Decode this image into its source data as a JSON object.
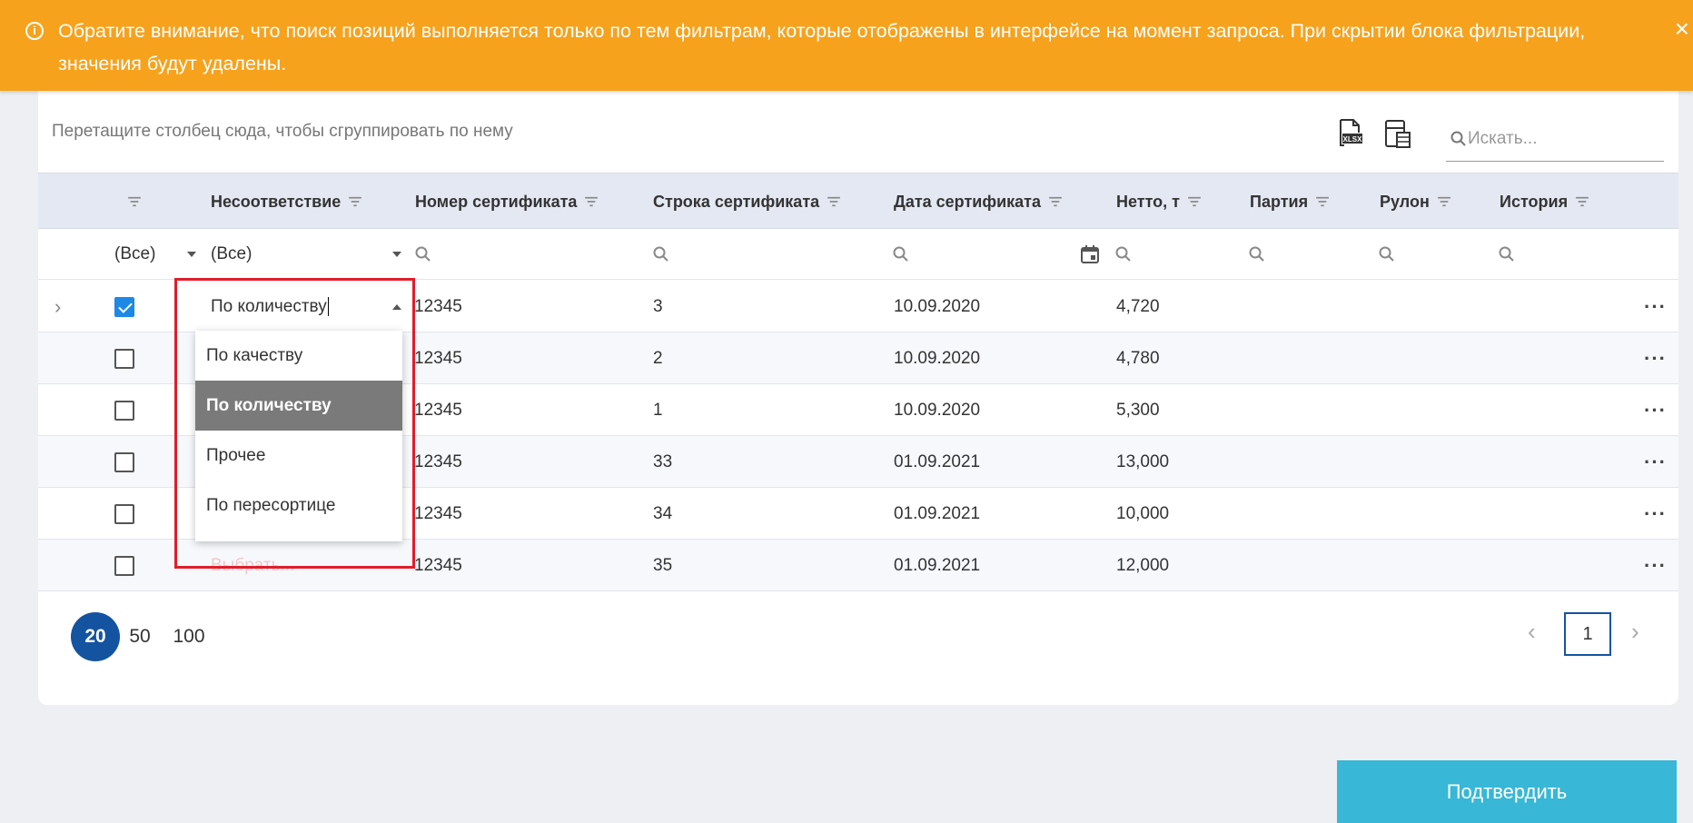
{
  "banner": {
    "text": "Обратите внимание, что поиск позиций выполняется только по тем фильтрам, которые отображены в интерфейсе на момент запроса. При скрытии блока фильтрации, значения будут удалены.",
    "icon": "info-icon",
    "close": "×"
  },
  "toolbar": {
    "group_hint": "Перетащите столбец сюда, чтобы сгруппировать по нему",
    "search_placeholder": "Искать..."
  },
  "columns": {
    "mismatch": "Несоответствие",
    "cert_number": "Номер сертификата",
    "cert_line": "Строка сертификата",
    "cert_date": "Дата сертификата",
    "net": "Нетто, т",
    "batch": "Партия",
    "roll": "Рулон",
    "history": "История"
  },
  "filters": {
    "select_all": "(Все)",
    "mismatch_all": "(Все)"
  },
  "rows": [
    {
      "checked": true,
      "mismatch": "По количеству",
      "cert_number": "12345",
      "cert_line": "3",
      "cert_date": "10.09.2020",
      "net": "4,720"
    },
    {
      "checked": false,
      "mismatch": "",
      "cert_number": "12345",
      "cert_line": "2",
      "cert_date": "10.09.2020",
      "net": "4,780"
    },
    {
      "checked": false,
      "mismatch": "",
      "cert_number": "12345",
      "cert_line": "1",
      "cert_date": "10.09.2020",
      "net": "5,300"
    },
    {
      "checked": false,
      "mismatch": "",
      "cert_number": "12345",
      "cert_line": "33",
      "cert_date": "01.09.2021",
      "net": "13,000"
    },
    {
      "checked": false,
      "mismatch": "",
      "cert_number": "12345",
      "cert_line": "34",
      "cert_date": "01.09.2021",
      "net": "10,000"
    },
    {
      "checked": false,
      "mismatch": "Выбрать...",
      "cert_number": "12345",
      "cert_line": "35",
      "cert_date": "01.09.2021",
      "net": "12,000"
    }
  ],
  "dropdown": {
    "options": [
      "По качеству",
      "По количеству",
      "Прочее",
      "По пересортице"
    ],
    "selected": "По количеству"
  },
  "pagination": {
    "sizes": [
      "20",
      "50",
      "100"
    ],
    "active_size": "20",
    "current_page": "1"
  },
  "confirm_label": "Подтвердить",
  "colors": {
    "banner": "#f6a21d",
    "header_bg": "#e3e8f3",
    "accent_blue": "#1453a0",
    "checkbox_blue": "#1e88e5",
    "confirm": "#38b7d6",
    "highlight": "#e01d2a",
    "selected_option": "#7a7a7a"
  }
}
